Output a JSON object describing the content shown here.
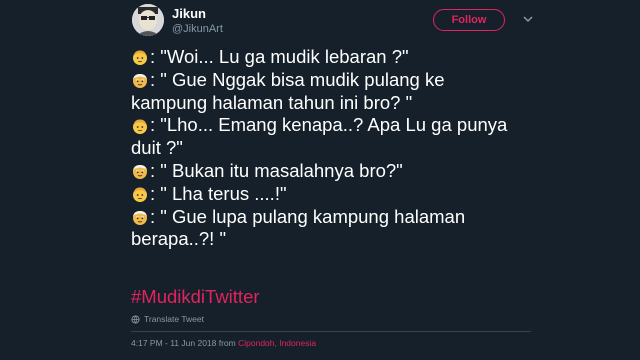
{
  "user": {
    "display_name": "Jikun",
    "handle": "@JikunArt"
  },
  "follow_label": "Follow",
  "tweet_lines": [
    {
      "emoji": "young-face",
      "text": ": \"Woi... Lu ga mudik lebaran ?\""
    },
    {
      "emoji": "old-face",
      "text": ": \" Gue Nggak bisa mudik pulang ke"
    },
    {
      "emoji": "",
      "text": "kampung halaman tahun ini bro? \""
    },
    {
      "emoji": "young-face",
      "text": ": \"Lho... Emang kenapa..? Apa Lu ga punya"
    },
    {
      "emoji": "",
      "text": "duit ?\""
    },
    {
      "emoji": "old-face",
      "text": ": \" Bukan itu masalahnya bro?\""
    },
    {
      "emoji": "young-face",
      "text": ": \" Lha terus ....!\""
    },
    {
      "emoji": "old-face",
      "text": ": \" Gue lupa pulang kampung halaman"
    },
    {
      "emoji": "",
      "text": "berapa..?! \""
    }
  ],
  "hashtag": "#MudikdiTwitter",
  "translate_label": "Translate Tweet",
  "timestamp": "4:17 PM - 11 Jun 2018 from",
  "location": "Cipondoh, Indonesia",
  "colors": {
    "background": "#15202b",
    "accent": "#e0245e",
    "muted": "#8899a6"
  }
}
